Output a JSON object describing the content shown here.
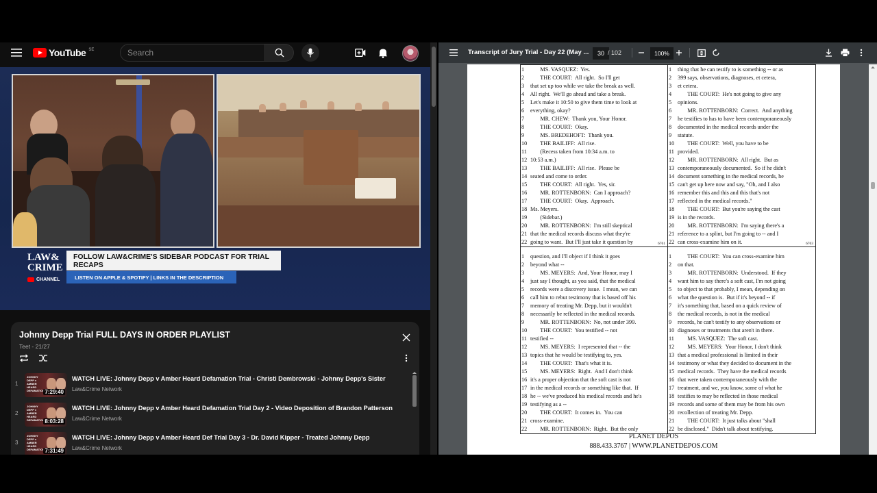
{
  "youtube": {
    "logo_text": "YouTube",
    "country_code": "SE",
    "search_placeholder": "Search",
    "video": {
      "logo_line1": "LAW&",
      "logo_line2": "CRIME",
      "logo_channel": "CHANNEL",
      "banner": "FOLLOW LAW&CRIME'S SIDEBAR PODCAST FOR TRIAL RECAPS",
      "banner_sub": "LISTEN ON APPLE & SPOTIFY | LINKS IN THE DESCRIPTION"
    },
    "playlist": {
      "title": "Johnny Depp Trial FULL DAYS IN ORDER PLAYLIST",
      "subtitle": "Teet - 21/27",
      "items": [
        {
          "index": "1",
          "title": "WATCH LIVE: Johnny Depp v Amber Heard Defamation Trial - Christi Dembrowski - Johnny Depp's Sister",
          "channel": "Law&Crime Network",
          "duration": "7:29:40",
          "thumb_tag": "JOHNNY DEPP v AMBER HEARD DEFAMATION"
        },
        {
          "index": "2",
          "title": "WATCH LIVE: Johnny Depp v Amber Heard Defamation Trial Day 2 - Video Deposition of Brandon Patterson",
          "channel": "Law&Crime Network",
          "duration": "8:03:28",
          "thumb_tag": "JOHNNY DEPP v AMBER HEARD DEFAMATION"
        },
        {
          "index": "3",
          "title": "WATCH LIVE: Johnny Depp v Amber Heard Def Trial Day 3 - Dr. David Kipper - Treated Johnny Depp",
          "channel": "Law&Crime Network",
          "duration": "7:31:49",
          "thumb_tag": "JOHNNY DEPP v AMBER HEARD DEFAMATION"
        }
      ]
    }
  },
  "pdf": {
    "title": "Transcript of Jury Trial - Day 22 (May ...",
    "current_page": "30",
    "total_pages": "/ 102",
    "zoom": "100%",
    "quads": [
      {
        "page_no": "6761",
        "lines": [
          {
            "n": "1",
            "t": "        MS. VASQUEZ:  Yes."
          },
          {
            "n": "2",
            "t": "        THE COURT:  All right.  So I'll get"
          },
          {
            "n": "3",
            "t": " that set up too while we take the break as well."
          },
          {
            "n": "4",
            "t": " All right.  We'll go ahead and take a break."
          },
          {
            "n": "5",
            "t": " Let's make it 10:50 to give them time to look at"
          },
          {
            "n": "6",
            "t": " everything, okay?"
          },
          {
            "n": "7",
            "t": "        MR. CHEW:  Thank you, Your Honor."
          },
          {
            "n": "8",
            "t": "        THE COURT:  Okay."
          },
          {
            "n": "9",
            "t": "        MS. BREDEHOFT:  Thank you."
          },
          {
            "n": "10",
            "t": "        THE BAILIFF:  All rise."
          },
          {
            "n": "11",
            "t": "        (Recess taken from 10:34 a.m. to"
          },
          {
            "n": "12",
            "t": " 10:53 a.m.)"
          },
          {
            "n": "13",
            "t": "        THE BAILIFF:  All rise.  Please be"
          },
          {
            "n": "14",
            "t": " seated and come to order."
          },
          {
            "n": "15",
            "t": "        THE COURT:  All right.  Yes, sir."
          },
          {
            "n": "16",
            "t": "        MR. ROTTENBORN:  Can I approach?"
          },
          {
            "n": "17",
            "t": "        THE COURT:  Okay.  Approach."
          },
          {
            "n": "18",
            "t": " Ms. Meyers."
          },
          {
            "n": "19",
            "t": "        (Sidebar.)"
          },
          {
            "n": "20",
            "t": "        MR. ROTTENBORN:  I'm still skeptical"
          },
          {
            "n": "21",
            "t": " that the medical records discuss what they're"
          },
          {
            "n": "22",
            "t": " going to want.  But I'll just take it question by"
          }
        ]
      },
      {
        "page_no": "6763",
        "lines": [
          {
            "n": "1",
            "t": " thing that he can testify to is something -- or as"
          },
          {
            "n": "2",
            "t": " 399 says, observations, diagnoses, et cetera,"
          },
          {
            "n": "3",
            "t": " et cetera."
          },
          {
            "n": "4",
            "t": "        THE COURT:  He's not going to give any"
          },
          {
            "n": "5",
            "t": " opinions."
          },
          {
            "n": "6",
            "t": "        MR. ROTTENBORN:  Correct.  And anything"
          },
          {
            "n": "7",
            "t": " he testifies to has to have been contemporaneously"
          },
          {
            "n": "8",
            "t": " documented in the medical records under the"
          },
          {
            "n": "9",
            "t": " statute."
          },
          {
            "n": "10",
            "t": "        THE COURT:  Well, you have to be"
          },
          {
            "n": "11",
            "t": " provided."
          },
          {
            "n": "12",
            "t": "        MR. ROTTENBORN:  All right.  But as"
          },
          {
            "n": "13",
            "t": " contemporaneously documented.  So if he didn't"
          },
          {
            "n": "14",
            "t": " document something in the medical records, he"
          },
          {
            "n": "15",
            "t": " can't get up here now and say, \"Oh, and I also"
          },
          {
            "n": "16",
            "t": " remember this and this and this that's not"
          },
          {
            "n": "17",
            "t": " reflected in the medical records.\""
          },
          {
            "n": "18",
            "t": "        THE COURT:  But you're saying the cast"
          },
          {
            "n": "19",
            "t": " is in the records."
          },
          {
            "n": "20",
            "t": "        MR. ROTTENBORN:  I'm saying there's a"
          },
          {
            "n": "21",
            "t": " reference to a splint, but I'm going to -- and I"
          },
          {
            "n": "22",
            "t": " can cross-examine him on it."
          }
        ]
      },
      {
        "page_no": "",
        "lines": [
          {
            "n": "1",
            "t": " question, and I'll object if I think it goes"
          },
          {
            "n": "2",
            "t": " beyond what --"
          },
          {
            "n": "3",
            "t": "        MS. MEYERS:  And, Your Honor, may I"
          },
          {
            "n": "4",
            "t": " just say I thought, as you said, that the medical"
          },
          {
            "n": "5",
            "t": " records were a discovery issue.  I mean, we can"
          },
          {
            "n": "6",
            "t": " call him to rebut testimony that is based off his"
          },
          {
            "n": "7",
            "t": " memory of treating Mr. Depp, but it wouldn't"
          },
          {
            "n": "8",
            "t": " necessarily be reflected in the medical records."
          },
          {
            "n": "9",
            "t": "        MR. ROTTENBORN:  No, not under 399."
          },
          {
            "n": "10",
            "t": "        THE COURT:  You testified -- not"
          },
          {
            "n": "11",
            "t": " testified --"
          },
          {
            "n": "12",
            "t": "        MS. MEYERS:  I represented that -- the"
          },
          {
            "n": "13",
            "t": " topics that he would be testifying to, yes."
          },
          {
            "n": "14",
            "t": "        THE COURT:  That's what it is."
          },
          {
            "n": "15",
            "t": "        MS. MEYERS:  Right.  And I don't think"
          },
          {
            "n": "16",
            "t": " it's a proper objection that the soft cast is not"
          },
          {
            "n": "17",
            "t": " in the medical records or something like that.  If"
          },
          {
            "n": "18",
            "t": " he -- we've produced his medical records and he's"
          },
          {
            "n": "19",
            "t": " testifying as a --"
          },
          {
            "n": "20",
            "t": "        THE COURT:  It comes in.  You can"
          },
          {
            "n": "21",
            "t": " cross-examine."
          },
          {
            "n": "22",
            "t": "        MR. ROTTENBORN:  Right.  But the only"
          }
        ]
      },
      {
        "page_no": "",
        "lines": [
          {
            "n": "1",
            "t": "        THE COURT:  You can cross-examine him"
          },
          {
            "n": "2",
            "t": " on that."
          },
          {
            "n": "3",
            "t": "        MR. ROTTENBORN:  Understood.  If they"
          },
          {
            "n": "4",
            "t": " want him to say there's a soft cast, I'm not going"
          },
          {
            "n": "5",
            "t": " to object to that probably, I mean, depending on"
          },
          {
            "n": "6",
            "t": " what the question is.  But if it's beyond -- if"
          },
          {
            "n": "7",
            "t": " it's something that, based on a quick review of"
          },
          {
            "n": "8",
            "t": " the medical records, is not in the medical"
          },
          {
            "n": "9",
            "t": " records, he can't testify to any observations or"
          },
          {
            "n": "10",
            "t": " diagnoses or treatments that aren't in there."
          },
          {
            "n": "11",
            "t": "        MS. VASQUEZ:  The soft cast."
          },
          {
            "n": "12",
            "t": "        MS. MEYERS:  Your Honor, I don't think"
          },
          {
            "n": "13",
            "t": " that a medical professional is limited in their"
          },
          {
            "n": "14",
            "t": " testimony or what they decided to document in the"
          },
          {
            "n": "15",
            "t": " medical records.  They have the medical records"
          },
          {
            "n": "16",
            "t": " that were taken contemporaneously with the"
          },
          {
            "n": "17",
            "t": " treatment, and we, you know, some of what he"
          },
          {
            "n": "18",
            "t": " testifies to may be reflected in those medical"
          },
          {
            "n": "19",
            "t": " records and some of them may be from his own"
          },
          {
            "n": "20",
            "t": " recollection of treating Mr. Depp."
          },
          {
            "n": "21",
            "t": "        THE COURT:  It just talks about \"shall"
          },
          {
            "n": "22",
            "t": " be disclosed.\"  Didn't talk about testifying."
          }
        ]
      }
    ],
    "footer_line1": "PLANET DEPOS",
    "footer_line2": "888.433.3767 | WWW.PLANETDEPOS.COM"
  },
  "colors": {
    "youtube_red": "#ff0000",
    "pdf_toolbar": "#323639",
    "pdf_bg": "#525659",
    "banner_blue": "#2b63b8"
  },
  "icons": [
    "menu-icon",
    "search-icon",
    "mic-icon",
    "create-icon",
    "bell-icon",
    "close-icon",
    "loop-icon",
    "shuffle-icon",
    "more-icon",
    "zoom-out-icon",
    "zoom-in-icon",
    "fit-page-icon",
    "rotate-icon",
    "download-icon",
    "print-icon"
  ]
}
